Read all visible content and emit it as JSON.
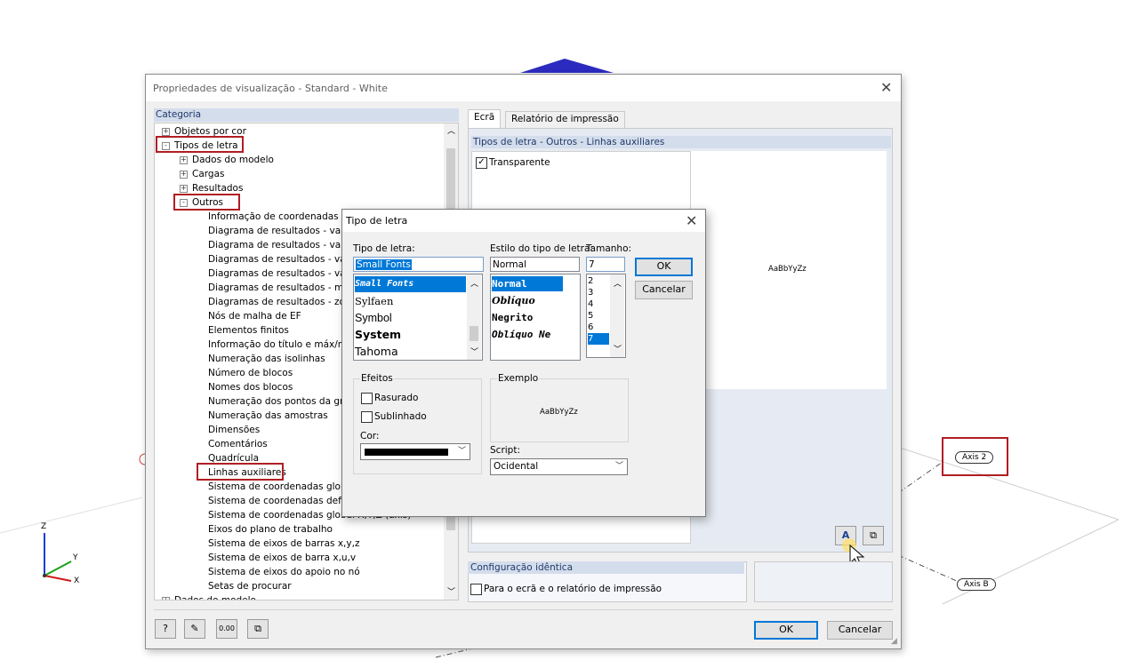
{
  "main_dialog": {
    "title": "Propriedades de visualização - Standard - White",
    "category_header": "Categoria",
    "tree_items": [
      {
        "label": "Objetos por cor",
        "level": 0,
        "toggle": "+"
      },
      {
        "label": "Tipos de letra",
        "level": 0,
        "toggle": "−"
      },
      {
        "label": "Dados do modelo",
        "level": 1,
        "toggle": "+"
      },
      {
        "label": "Cargas",
        "level": 1,
        "toggle": "+"
      },
      {
        "label": "Resultados",
        "level": 1,
        "toggle": "+"
      },
      {
        "label": "Outros",
        "level": 1,
        "toggle": "−"
      },
      {
        "label": "Informação de coordenadas no",
        "level": 2
      },
      {
        "label": "Diagrama de resultados - valore",
        "level": 2
      },
      {
        "label": "Diagrama de resultados - valore",
        "level": 2
      },
      {
        "label": "Diagramas de resultados - valor",
        "level": 2
      },
      {
        "label": "Diagramas de resultados - valor",
        "level": 2
      },
      {
        "label": "Diagramas de resultados - médi",
        "level": 2
      },
      {
        "label": "Diagramas de resultados - zona",
        "level": 2
      },
      {
        "label": "Nós de malha de EF",
        "level": 2
      },
      {
        "label": "Elementos finitos",
        "level": 2
      },
      {
        "label": "Informação do título e máx/mín",
        "level": 2
      },
      {
        "label": "Numeração das isolinhas",
        "level": 2
      },
      {
        "label": "Número de blocos",
        "level": 2
      },
      {
        "label": "Nomes dos blocos",
        "level": 2
      },
      {
        "label": "Numeração dos pontos da grelh",
        "level": 2
      },
      {
        "label": "Numeração das amostras",
        "level": 2
      },
      {
        "label": "Dimensões",
        "level": 2
      },
      {
        "label": "Comentários",
        "level": 2
      },
      {
        "label": "Quadrícula",
        "level": 2
      },
      {
        "label": "Linhas auxiliares",
        "level": 2
      },
      {
        "label": "Sistema de coordenadas global",
        "level": 2
      },
      {
        "label": "Sistema de coordenadas definid",
        "level": 2
      },
      {
        "label": "Sistema de coordenadas global X,Y,Z (axis)",
        "level": 2
      },
      {
        "label": "Eixos do plano de trabalho",
        "level": 2
      },
      {
        "label": "Sistema de eixos de barras x,y,z",
        "level": 2
      },
      {
        "label": "Sistema de eixos de barra x,u,v",
        "level": 2
      },
      {
        "label": "Sistema de eixos do apoio no nó",
        "level": 2
      },
      {
        "label": "Setas de procurar",
        "level": 2
      },
      {
        "label": "Dados do modelo",
        "level": 0,
        "toggle": "+"
      }
    ],
    "tabs": [
      "Ecrã",
      "Relatório de impressão"
    ],
    "section_header": "Tipos de letra - Outros - Linhas auxiliares",
    "transparent_label": "Transparente",
    "transparent_checked": true,
    "preview_text": "AaBbYyZz",
    "identical_config_header": "Configuração idêntica",
    "identical_config_label": "Para o ecrã e o relatório de impressão",
    "ok_label": "OK",
    "cancel_label": "Cancelar",
    "bottom_icons": [
      "help-icon",
      "edit-icon",
      "decimal-icon",
      "copy-icon"
    ],
    "font_button_icons": [
      "font-icon",
      "copy-icon"
    ]
  },
  "font_dialog": {
    "title": "Tipo de letra",
    "font_label": "Tipo de letra:",
    "font_value": "Small Fonts",
    "font_list": [
      "Small Fonts",
      "Sylfaen",
      "Symbol",
      "System",
      "Tahoma"
    ],
    "style_label": "Estilo do tipo de letra:",
    "style_value": "Normal",
    "style_list": [
      "Normal",
      "Oblíquo",
      "Negrito",
      "Oblíquo Ne"
    ],
    "size_label": "Tamanho:",
    "size_value": "7",
    "size_list": [
      "2",
      "3",
      "4",
      "5",
      "6",
      "7"
    ],
    "ok_label": "OK",
    "cancel_label": "Cancelar",
    "effects_label": "Efeitos",
    "strike_label": "Rasurado",
    "underline_label": "Sublinhado",
    "color_label": "Cor:",
    "color_value": "#000000",
    "sample_label": "Exemplo",
    "sample_text": "AaBbYyZz",
    "script_label": "Script:",
    "script_value": "Ocidental"
  },
  "model_view": {
    "axis_labels": [
      "Axis 2",
      "Axis B"
    ],
    "coord_labels": [
      "Z",
      "Y",
      "X"
    ]
  },
  "colors": {
    "highlight": "#b01e23",
    "selection": "#0078d7",
    "header_bg": "#d4ddec"
  }
}
